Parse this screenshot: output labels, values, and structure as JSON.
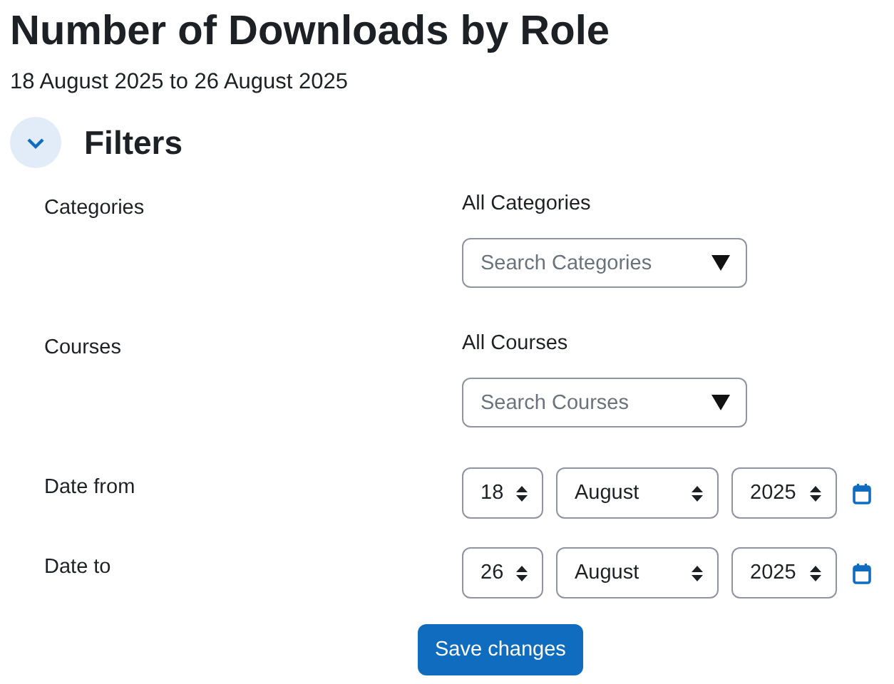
{
  "page": {
    "title": "Number of Downloads by Role",
    "subtitle": "18 August 2025 to 26 August 2025"
  },
  "filters": {
    "heading": "Filters",
    "expanded": true,
    "rows": [
      {
        "kind": "autocomplete",
        "label": "Categories",
        "selection": "All Categories",
        "placeholder": "Search Categories"
      },
      {
        "kind": "autocomplete",
        "label": "Courses",
        "selection": "All Courses",
        "placeholder": "Search Courses"
      },
      {
        "kind": "date",
        "label": "Date from",
        "day": "18",
        "month": "August",
        "year": "2025"
      },
      {
        "kind": "date",
        "label": "Date to",
        "day": "26",
        "month": "August",
        "year": "2025"
      }
    ],
    "submit": "Save changes"
  }
}
